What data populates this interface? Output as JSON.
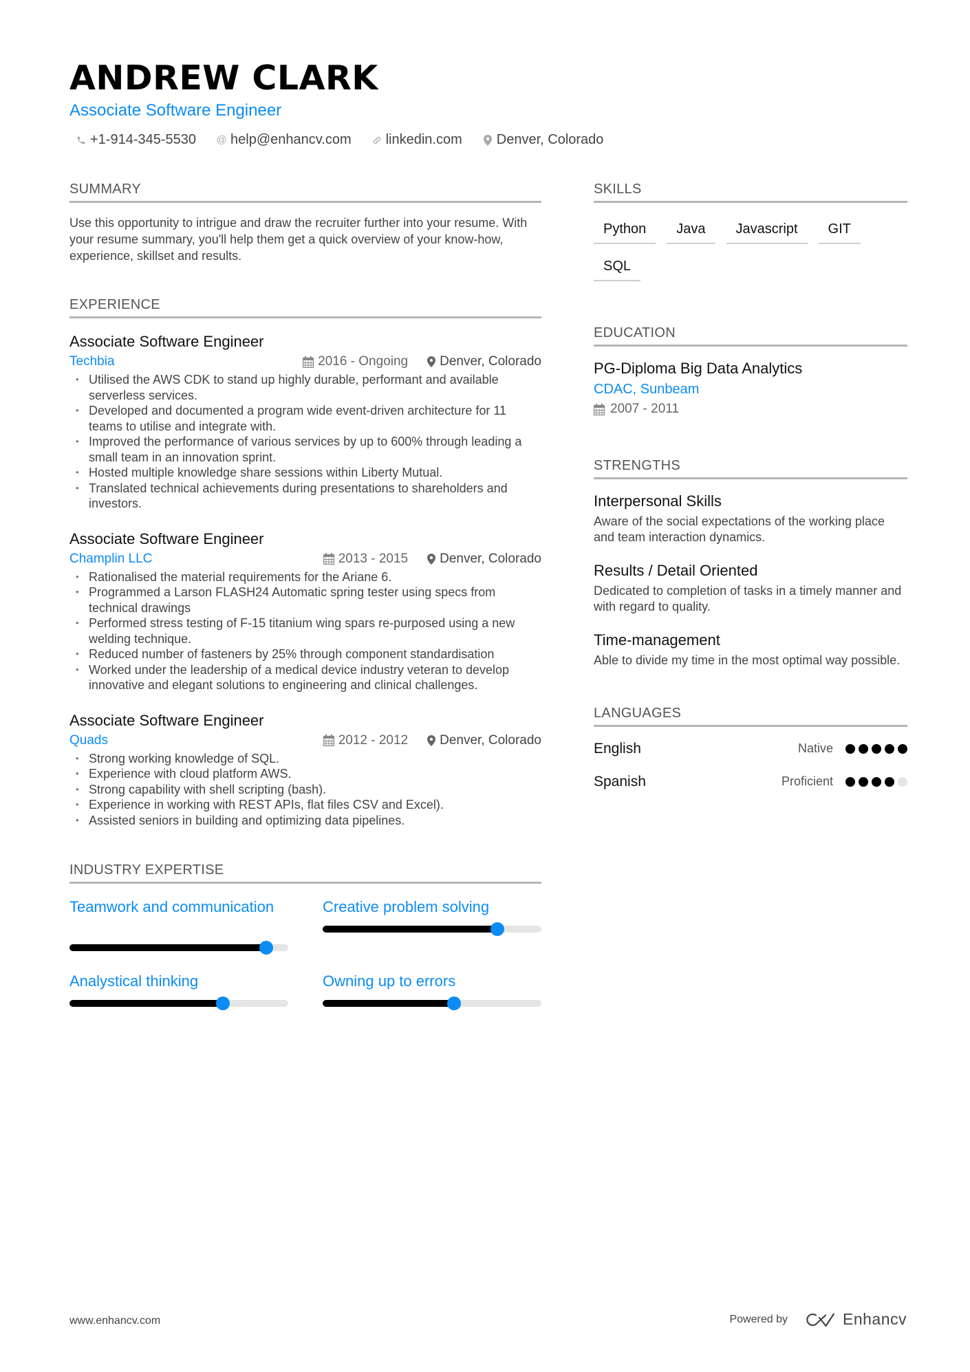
{
  "header": {
    "name": "ANDREW CLARK",
    "title": "Associate Software Engineer",
    "contacts": [
      {
        "icon": "phone-icon",
        "text": "+1-914-345-5530"
      },
      {
        "icon": "at-icon",
        "text": "help@enhancv.com"
      },
      {
        "icon": "link-icon",
        "text": "linkedin.com"
      },
      {
        "icon": "location-pin-icon",
        "text": "Denver, Colorado"
      }
    ]
  },
  "colors": {
    "accent": "#0b8cf5",
    "text": "#111111",
    "muted": "#444444",
    "divider": "#b5b5b5",
    "slider_track": "#e5e5e5",
    "slider_fill": "#000000"
  },
  "summary": {
    "heading": "SUMMARY",
    "text": "Use this opportunity to intrigue and draw the recruiter further into your resume. With your resume summary, you'll help them get a quick overview of your know-how, experience, skillset and results."
  },
  "experience": {
    "heading": "EXPERIENCE",
    "jobs": [
      {
        "role": "Associate Software Engineer",
        "company": "Techbia",
        "dates": "2016 - Ongoing",
        "location": "Denver, Colorado",
        "bullets": [
          "Utilised the AWS CDK to stand up highly durable, performant and available serverless services.",
          "Developed and documented a program wide event-driven architecture for 11 teams to utilise and integrate with.",
          "Improved the performance of various services by up to 600% through leading a small team in an innovation sprint.",
          "Hosted multiple knowledge share sessions within Liberty Mutual.",
          "Translated technical achievements during presentations to shareholders and investors."
        ]
      },
      {
        "role": "Associate Software Engineer",
        "company": "Champlin LLC",
        "dates": "2013 - 2015",
        "location": "Denver, Colorado",
        "bullets": [
          "Rationalised the material requirements for the Ariane 6.",
          "Programmed a Larson FLASH24 Automatic spring tester using specs from technical drawings",
          "Performed stress testing of F-15 titanium wing spars re-purposed using a new welding technique.",
          "Reduced number of fasteners by 25% through component standardisation",
          "Worked under the leadership of a medical device industry veteran to develop innovative and elegant solutions to engineering and clinical challenges."
        ]
      },
      {
        "role": "Associate Software Engineer",
        "company": "Quads",
        "dates": "2012 - 2012",
        "location": "Denver, Colorado",
        "bullets": [
          "Strong working knowledge of SQL.",
          "Experience with cloud platform AWS.",
          "Strong capability with shell scripting (bash).",
          "Experience in working with REST APIs, flat files CSV and Excel).",
          "Assisted seniors in building and optimizing data pipelines."
        ]
      }
    ]
  },
  "industry_expertise": {
    "heading": "INDUSTRY EXPERTISE",
    "items": [
      {
        "label": "Teamwork and communication",
        "level_percent": 90
      },
      {
        "label": "Creative problem solving",
        "level_percent": 80
      },
      {
        "label": "Analystical thinking",
        "level_percent": 70
      },
      {
        "label": "Owning up to errors",
        "level_percent": 60
      }
    ]
  },
  "skills": {
    "heading": "SKILLS",
    "items": [
      "Python",
      "Java",
      "Javascript",
      "GIT",
      "SQL"
    ]
  },
  "education": {
    "heading": "EDUCATION",
    "items": [
      {
        "degree": "PG-Diploma Big Data Analytics",
        "school": "CDAC, Sunbeam",
        "dates": "2007 - 2011"
      }
    ]
  },
  "strengths": {
    "heading": "STRENGTHS",
    "items": [
      {
        "title": "Interpersonal Skills",
        "description": "Aware of the social expectations of the working place and team interaction dynamics."
      },
      {
        "title": "Results / Detail Oriented",
        "description": "Dedicated to completion of tasks in a timely manner and with regard to quality."
      },
      {
        "title": "Time-management",
        "description": "Able to divide my time in the most optimal way possible."
      }
    ]
  },
  "languages": {
    "heading": "LANGUAGES",
    "items": [
      {
        "name": "English",
        "level": "Native",
        "rating": 5,
        "max": 5
      },
      {
        "name": "Spanish",
        "level": "Proficient",
        "rating": 4,
        "max": 5
      }
    ]
  },
  "footer": {
    "website": "www.enhancv.com",
    "powered_by": "Powered by",
    "brand": "Enhancv"
  }
}
